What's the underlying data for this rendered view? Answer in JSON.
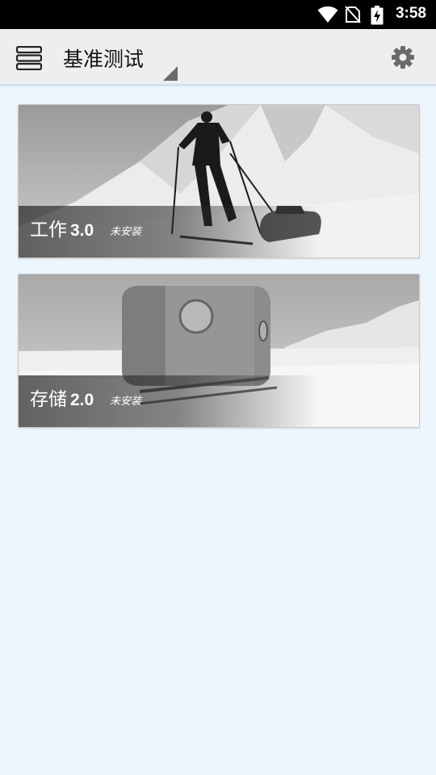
{
  "status_bar": {
    "time": "3:58",
    "icons": [
      "wifi-icon",
      "no-sim-icon",
      "battery-charging-icon"
    ]
  },
  "app_bar": {
    "menu_icon": "menu-icon",
    "title": "基准测试",
    "settings_icon": "gear-icon"
  },
  "benchmarks": [
    {
      "name": "工作",
      "version": "3.0",
      "status": "未安装",
      "image": "skier-pulling-sled-in-snow"
    },
    {
      "name": "存储",
      "version": "2.0",
      "status": "未安装",
      "image": "cabin-on-sled-in-snow"
    }
  ]
}
